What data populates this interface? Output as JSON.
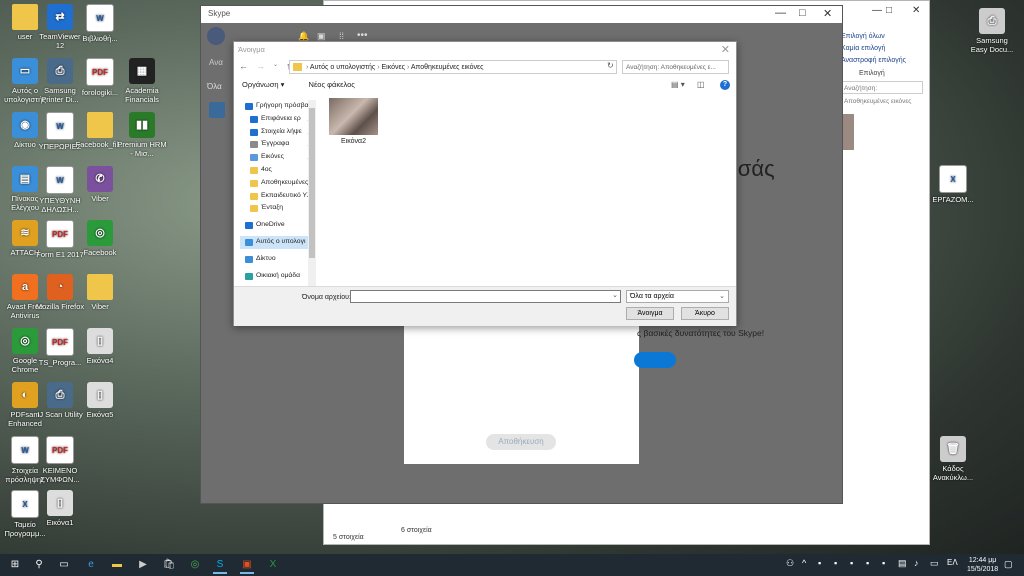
{
  "desktop": {
    "icons": [
      {
        "label": "user",
        "color": "#f0c64a",
        "type": "folder"
      },
      {
        "label": "TeamViewer 12",
        "color": "#1e6fd0",
        "type": "app",
        "glyph": "⇄"
      },
      {
        "label": "Βιβλιοθή...",
        "color": "#fff",
        "type": "doc",
        "glyph": "W"
      },
      {
        "label": "Αυτός ο υπολογιστής",
        "color": "#3a8fd8",
        "type": "app",
        "glyph": "▭"
      },
      {
        "label": "Samsung Printer Di...",
        "color": "#4a6a8a",
        "type": "app",
        "glyph": "⎙"
      },
      {
        "label": "forologiki...",
        "color": "#fff",
        "type": "pdf",
        "glyph": "PDF"
      },
      {
        "label": "Academia Financials",
        "color": "#222",
        "type": "app",
        "glyph": "▦"
      },
      {
        "label": "Δίκτυο",
        "color": "#3a8fd8",
        "type": "app",
        "glyph": "◉"
      },
      {
        "label": "ΥΠΕΡΩΡΙΕΣ",
        "color": "#fff",
        "type": "doc",
        "glyph": "W"
      },
      {
        "label": "Facebook_fil...",
        "color": "#f0c64a",
        "type": "folder"
      },
      {
        "label": "Premium HRM - Μισ...",
        "color": "#2a7a2a",
        "type": "app",
        "glyph": "▮▮"
      },
      {
        "label": "Πίνακας Ελέγχου",
        "color": "#3a8fd8",
        "type": "app",
        "glyph": "▤"
      },
      {
        "label": "ΥΠΕΥΘΥΝΗ ΔΗΛΩΣΗ...",
        "color": "#fff",
        "type": "doc",
        "glyph": "W"
      },
      {
        "label": "Viber",
        "color": "#7b519d",
        "type": "app",
        "glyph": "✆"
      },
      {
        "label": "ATTACH",
        "color": "#e0a020",
        "type": "app",
        "glyph": "≋"
      },
      {
        "label": "Form E1 2017",
        "color": "#fff",
        "type": "pdf",
        "glyph": "PDF"
      },
      {
        "label": "Facebook",
        "color": "#2a9a3a",
        "type": "app",
        "glyph": "◎"
      },
      {
        "label": "Avast Free Antivirus",
        "color": "#f07020",
        "type": "app",
        "glyph": "a"
      },
      {
        "label": "Mozilla Firefox",
        "color": "#e06020",
        "type": "app",
        "glyph": "◔"
      },
      {
        "label": "Viber",
        "color": "#f0c64a",
        "type": "folder"
      },
      {
        "label": "Google Chrome",
        "color": "#2a9a3a",
        "type": "app",
        "glyph": "◎"
      },
      {
        "label": "TS_Progra...",
        "color": "#fff",
        "type": "pdf",
        "glyph": "PDF"
      },
      {
        "label": "Εικόνα4",
        "color": "#ddd",
        "type": "app",
        "glyph": "▯"
      },
      {
        "label": "PDFsam Enhanced",
        "color": "#e0a020",
        "type": "app",
        "glyph": "◐"
      },
      {
        "label": "IJ Scan Utility",
        "color": "#4a6a8a",
        "type": "app",
        "glyph": "⎙"
      },
      {
        "label": "Εικόνα5",
        "color": "#ddd",
        "type": "app",
        "glyph": "▯"
      },
      {
        "label": "Στοιχεία πρόσληψης",
        "color": "#fff",
        "type": "doc",
        "glyph": "W"
      },
      {
        "label": "ΚΕΙΜΕΝΟ ΣΥΜΦΩΝ...",
        "color": "#fff",
        "type": "pdf",
        "glyph": "PDF"
      },
      {
        "label": "Ταμείο Προγραμμ...",
        "color": "#fff",
        "type": "doc",
        "glyph": "X"
      },
      {
        "label": "Εικόνα1",
        "color": "#ddd",
        "type": "app",
        "glyph": "▯"
      },
      {
        "label": "Samsung Easy Docu...",
        "color": "#ccc",
        "type": "app",
        "glyph": "⎙"
      },
      {
        "label": "ΕΡΓΑΖΟΜ...",
        "color": "#fff",
        "type": "doc",
        "glyph": "X"
      },
      {
        "label": "Κάδος Ανακύκλω...",
        "color": "#ccc",
        "type": "app",
        "glyph": "🗑"
      }
    ]
  },
  "explorer": {
    "commands": [
      "Επιλογή όλων",
      "Καμία επιλογή",
      "Αναστροφή επιλογής"
    ],
    "group_label": "Επιλογή",
    "search_placeholder": "Αναζήτηση: Αποθηκευμένες εικόνες",
    "status_left": "5 στοιχεία",
    "status_right": "6 στοιχεία"
  },
  "skype": {
    "title": "Skype",
    "partial_heading": "εσάς",
    "features_text": "ς βασικές δυνατότητες του Skype!",
    "finish_button": "Αποθήκευση",
    "sidebar_text_1": "Ανα",
    "sidebar_text_2": "Όλα"
  },
  "open_dialog": {
    "title": "Άνοιγμα",
    "breadcrumb": [
      "Αυτός ο υπολογιστής",
      "Εικόνες",
      "Αποθηκευμένες εικόνες"
    ],
    "search_placeholder": "Αναζήτηση: Αποθηκευμένες ε...",
    "toolbar": {
      "organize": "Οργάνωση ▾",
      "new_folder": "Νέος φάκελος"
    },
    "nav_items": [
      {
        "label": "Γρήγορη πρόσβα",
        "color": "#1e6fd0",
        "indent": 0,
        "pinned": false,
        "selected": false
      },
      {
        "label": "Επιφάνεια ερ",
        "color": "#1e6fd0",
        "indent": 1,
        "pinned": true,
        "selected": false
      },
      {
        "label": "Στοιχεία λήψε",
        "color": "#1e6fd0",
        "indent": 1,
        "pinned": true,
        "selected": false
      },
      {
        "label": "Έγγραφα",
        "color": "#8a8a8a",
        "indent": 1,
        "pinned": true,
        "selected": false
      },
      {
        "label": "Εικόνες",
        "color": "#5a9ad8",
        "indent": 1,
        "pinned": true,
        "selected": false
      },
      {
        "label": "4ος",
        "color": "#f0c64a",
        "indent": 1,
        "pinned": false,
        "selected": false
      },
      {
        "label": "Αποθηκευμένες",
        "color": "#f0c64a",
        "indent": 1,
        "pinned": false,
        "selected": false
      },
      {
        "label": "Εκπαιδευτικό Υλ",
        "color": "#f0c64a",
        "indent": 1,
        "pinned": false,
        "selected": false
      },
      {
        "label": "Ένταξη",
        "color": "#f0c64a",
        "indent": 1,
        "pinned": false,
        "selected": false
      },
      {
        "label": "OneDrive",
        "color": "#1e6fd0",
        "indent": 0,
        "pinned": false,
        "selected": false
      },
      {
        "label": "Αυτός ο υπολογι",
        "color": "#3a8fd8",
        "indent": 0,
        "pinned": false,
        "selected": true
      },
      {
        "label": "Δίκτυο",
        "color": "#3a8fd8",
        "indent": 0,
        "pinned": false,
        "selected": false
      },
      {
        "label": "Οικιακή ομάδα",
        "color": "#2aa0a0",
        "indent": 0,
        "pinned": false,
        "selected": false
      }
    ],
    "file": {
      "name": "Εικόνα2"
    },
    "filename_label": "Όνομα αρχείου:",
    "filename_value": "",
    "filter_value": "Όλα τα αρχεία",
    "open_button": "Άνοιγμα",
    "cancel_button": "Άκυρο"
  },
  "taskbar": {
    "tray_lang": "ΕΛ",
    "time": "12:44 μμ",
    "date": "15/5/2018"
  }
}
